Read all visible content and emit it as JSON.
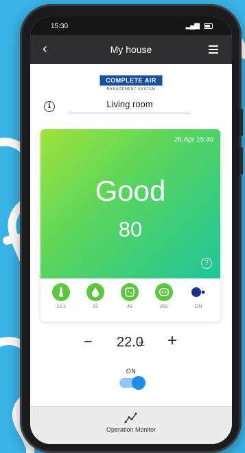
{
  "status_bar": {
    "time": "15:30"
  },
  "header": {
    "title": "My house"
  },
  "logo": {
    "brand": "COMPLETE AIR",
    "subtitle": "MANAGEMENT SYSTEM"
  },
  "room": {
    "name": "Living room"
  },
  "air_card": {
    "datetime": "28.Apr 15:30",
    "quality": "Good",
    "score": "80",
    "help_glyph": "?"
  },
  "sensors": [
    {
      "icon": "thermometer-icon",
      "value": "23.3"
    },
    {
      "icon": "humidity-drop-icon",
      "value": "63"
    },
    {
      "icon": "dust-sensor-icon",
      "value": "49"
    },
    {
      "icon": "co2-sensor-icon",
      "value": "850"
    },
    {
      "icon": "fan-on-icon",
      "value": "ON"
    }
  ],
  "temperature": {
    "value": "22.0",
    "unit": "℃",
    "minus": "−",
    "plus": "+"
  },
  "power": {
    "label": "ON",
    "state_on": true
  },
  "bottom_nav": {
    "label": "Operation Monitor"
  },
  "colors": {
    "accent_green": "#5cc63e",
    "toggle_blue": "#1f8ee8",
    "header_bg": "#2f2f31",
    "page_bg": "#3ab3e6"
  }
}
